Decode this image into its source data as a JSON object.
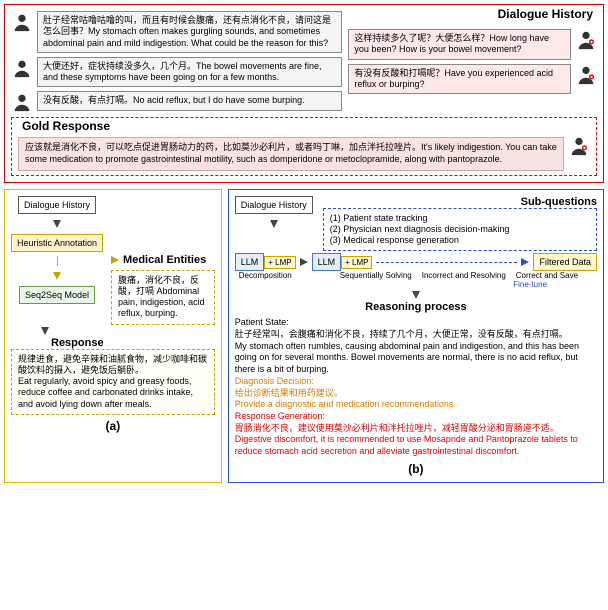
{
  "top": {
    "dialogueHistoryLabel": "Dialogue History",
    "patientMsgs": [
      "肚子经常咕噜咕噜的叫，而且有时候会腹痛，还有点消化不良，请问这是怎么回事？My stomach often makes gurgling sounds, and sometimes abdominal pain and mild indigestion. What could be the reason for this?",
      "大便还好，症状持续没多久，几个月。The bowel movements are fine, and these symptoms have been going on for a few months.",
      "没有反酸，有点打嗝。No acid reflux, but I do have some burping."
    ],
    "doctorMsgs": [
      "这样持续多久了呢？大便怎么样？How long have you been? How is your bowel movement?",
      "有没有反酸和打嗝呢？Have you experienced acid reflux or burping?"
    ]
  },
  "gold": {
    "label": "Gold Response",
    "body": "应该就是消化不良，可以吃点促进胃肠动力的药，比如莫沙必利片，或者吗丁啉，加点泮托拉唑片。It's likely indigestion. You can take some medication to promote gastrointestinal motility, such as domperidone or metoclopramide, along with pantoprazole."
  },
  "a": {
    "dh": "Dialogue History",
    "ha": "Heuristic Annotation",
    "seq": "Seq2Seq Model",
    "meTitle": "Medical Entities",
    "meBody": "腹痛，消化不良，反酸，打嗝 Abdominal pain, indigestion, acid reflux, burping.",
    "respTitle": "Response",
    "respBody": "规律进食，避免辛辣和油腻食物，减少咖啡和碳酸饮料的摄入，避免饭后躺卧。\nEat regularly, avoid spicy and greasy foods, reduce coffee and carbonated drinks intake, and avoid lying down after meals.",
    "caption": "(a)"
  },
  "b": {
    "sqTitle": "Sub-questions",
    "sq1": "(1) Patient state tracking",
    "sq2": "(2) Physician next diagnosis decision-making",
    "sq3": "(3) Medical response generation",
    "dh": "Dialogue History",
    "llm": "LLM",
    "lmp": "+ LMP",
    "decomp": "Decomposition",
    "seqSolve": "Sequentially Solving",
    "incorrect": "Incorrect and Resolving",
    "correct": "Correct and Save",
    "fineTune": "Fine-tune",
    "filtered": "Filtered Data",
    "rpTitle": "Reasoning process",
    "psTitle": "Patient State:",
    "psBody": "肚子经常叫，会腹痛和消化不良，持续了几个月，大便正常，没有反酸，有点打嗝。\nMy stomach often rumbles, causing abdominal pain and indigestion, and this has been going on for several months. Bowel movements are normal, there is no acid reflux, but there is a bit of burping.",
    "ddTitle": "Diagnosis Decision:",
    "ddBody": "给出诊断结果和用药建议。\nProvide a diagnostic and medication recommendations.",
    "rgTitle": "Response Generation:",
    "rgBody": "胃肠消化不良，建议使用莫沙必利片和泮托拉唑片，减轻胃酸分泌和胃肠道不适。\nDigestive discomfort, it is recommended to use Mosapride and Pantoprazole tablets to reduce stomach acid secretion and alleviate gastrointestinal discomfort.",
    "caption": "(b)"
  }
}
